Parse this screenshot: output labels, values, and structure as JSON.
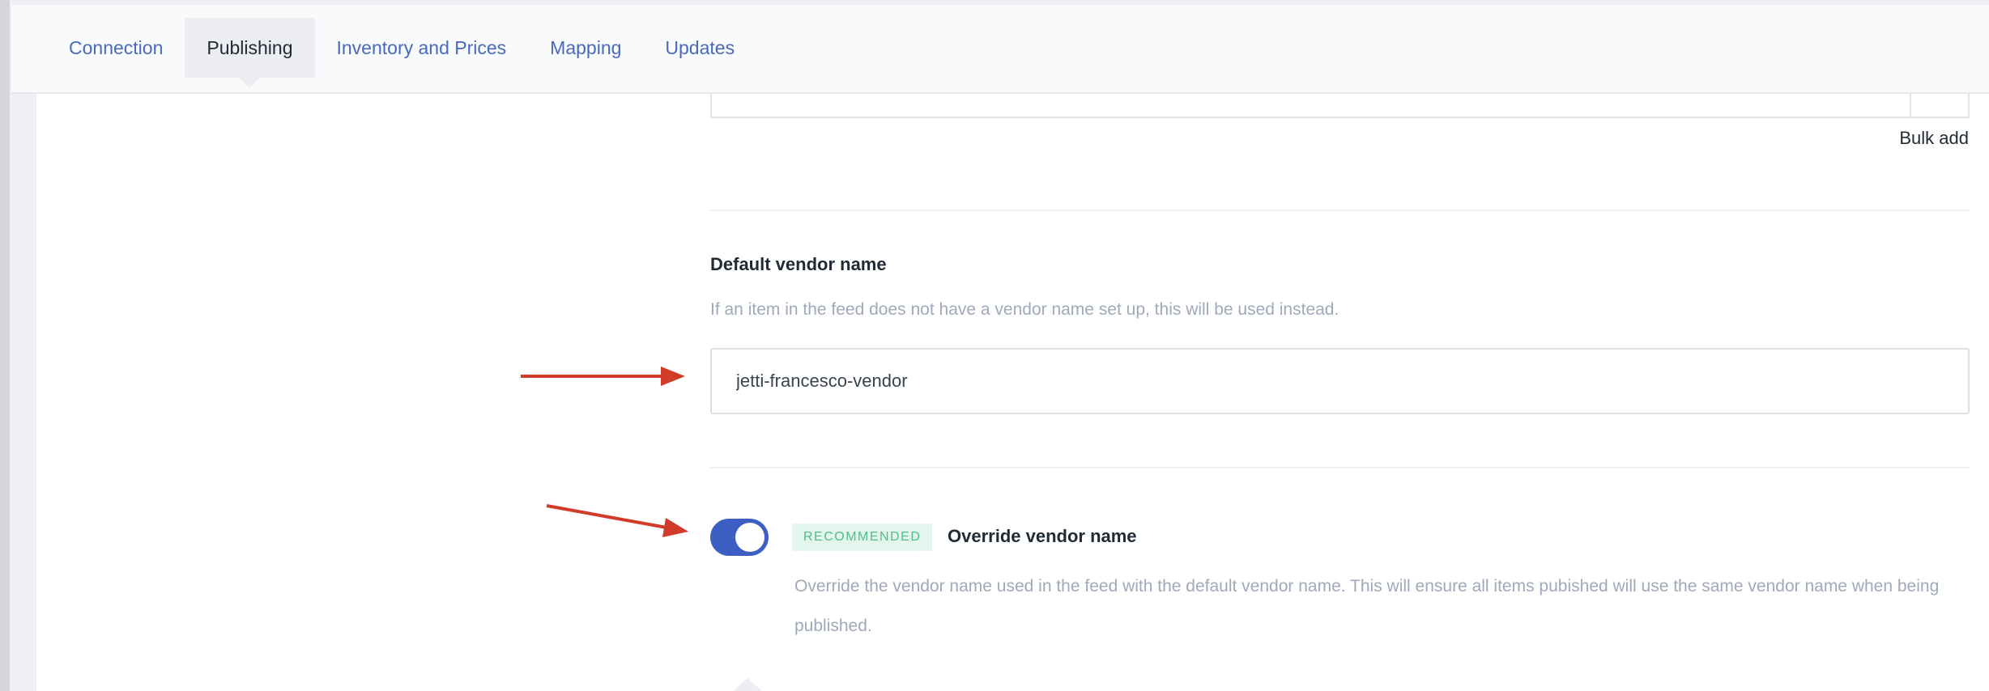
{
  "nav": {
    "tabs": [
      {
        "label": "Connection",
        "active": false
      },
      {
        "label": "Publishing",
        "active": true
      },
      {
        "label": "Inventory and Prices",
        "active": false
      },
      {
        "label": "Mapping",
        "active": false
      },
      {
        "label": "Updates",
        "active": false
      }
    ]
  },
  "bulk_add": {
    "label": "Bulk add"
  },
  "vendor": {
    "title": "Default vendor name",
    "help": "If an item in the feed does not have a vendor name set up, this will be used instead.",
    "value": "jetti-francesco-vendor"
  },
  "override": {
    "toggle_on": true,
    "badge": "RECOMMENDED",
    "title": "Override vendor name",
    "help": "Override the vendor name used in the feed with the default vendor name. This will ensure all items pubished will use the same vendor name when being published."
  },
  "colors": {
    "accent": "#3d5fc4",
    "link": "#4a69bd",
    "badge_bg": "#e3f5ec",
    "badge_text": "#4fbf8c",
    "annotation_arrow": "#d13b2a"
  }
}
